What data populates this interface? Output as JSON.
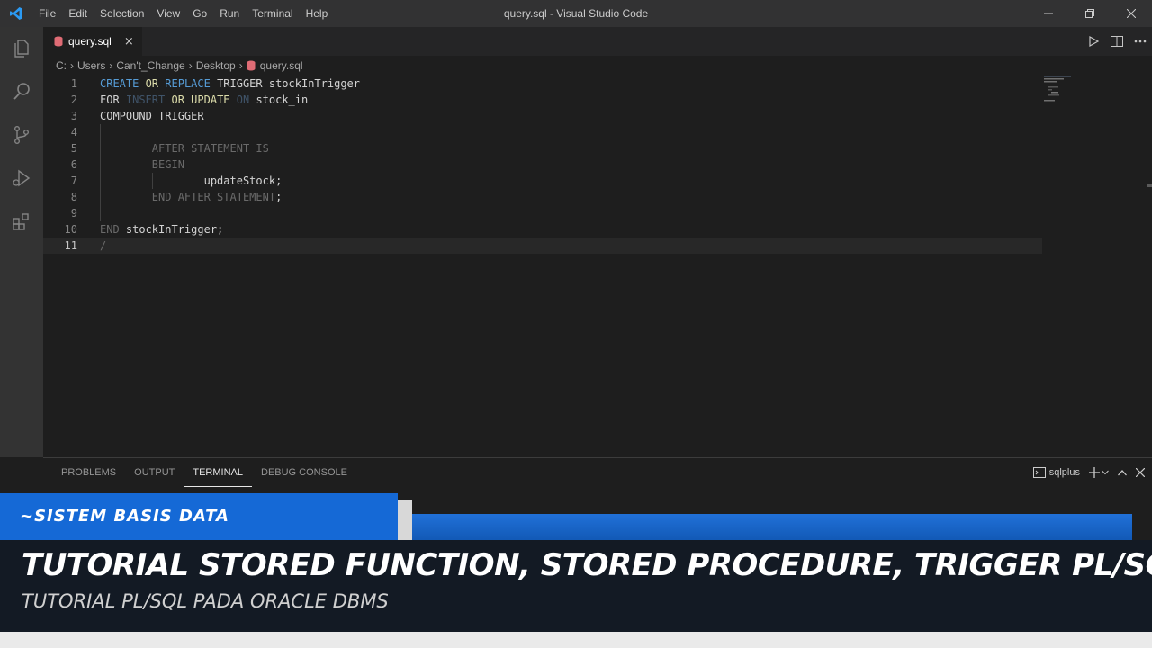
{
  "window": {
    "title": "query.sql - Visual Studio Code",
    "menu": [
      "File",
      "Edit",
      "Selection",
      "View",
      "Go",
      "Run",
      "Terminal",
      "Help"
    ]
  },
  "tab": {
    "label": "query.sql",
    "close": "×"
  },
  "breadcrumb": [
    "C:",
    "Users",
    "Can't_Change",
    "Desktop",
    "query.sql"
  ],
  "editor": {
    "lines": [
      {
        "n": "1",
        "parts": [
          [
            "k",
            "CREATE "
          ],
          [
            "y",
            "OR "
          ],
          [
            "k",
            "REPLACE "
          ],
          [
            "p",
            "TRIGGER stockInTrigger"
          ]
        ]
      },
      {
        "n": "2",
        "parts": [
          [
            "p",
            "FOR "
          ],
          [
            "kd",
            "INSERT "
          ],
          [
            "y",
            "OR "
          ],
          [
            "y",
            "UPDATE "
          ],
          [
            "kd",
            "ON "
          ],
          [
            "p",
            "stock_in"
          ]
        ]
      },
      {
        "n": "3",
        "parts": [
          [
            "p",
            "COMPOUND TRIGGER"
          ]
        ]
      },
      {
        "n": "4",
        "parts": []
      },
      {
        "n": "5",
        "parts": [
          [
            "p",
            "        "
          ],
          [
            "dim",
            "AFTER STATEMENT IS"
          ]
        ]
      },
      {
        "n": "6",
        "parts": [
          [
            "p",
            "        "
          ],
          [
            "dim",
            "BEGIN"
          ]
        ]
      },
      {
        "n": "7",
        "parts": [
          [
            "p",
            "                updateStock;"
          ]
        ]
      },
      {
        "n": "8",
        "parts": [
          [
            "p",
            "        "
          ],
          [
            "dim",
            "END AFTER STATEMENT"
          ],
          [
            "p",
            ";"
          ]
        ]
      },
      {
        "n": "9",
        "parts": []
      },
      {
        "n": "10",
        "parts": [
          [
            "dim",
            "END "
          ],
          [
            "p",
            "stockInTrigger;"
          ]
        ]
      },
      {
        "n": "11",
        "parts": [
          [
            "dim",
            "/"
          ]
        ]
      }
    ]
  },
  "panel": {
    "tabs": [
      "PROBLEMS",
      "OUTPUT",
      "TERMINAL",
      "DEBUG CONSOLE"
    ],
    "active": "TERMINAL",
    "terminal_name": "sqlplus"
  },
  "overlay": {
    "label": "~SISTEM BASIS DATA",
    "title": "TUTORIAL STORED FUNCTION, STORED PROCEDURE, TRIGGER PL/SQL",
    "subtitle": "TUTORIAL PL/SQL PADA ORACLE DBMS"
  },
  "colors": {
    "accent_blue": "#1569d6",
    "banner_dark": "#131a24",
    "keyword": "#569cd6",
    "function_yellow": "#dcdcaa"
  }
}
